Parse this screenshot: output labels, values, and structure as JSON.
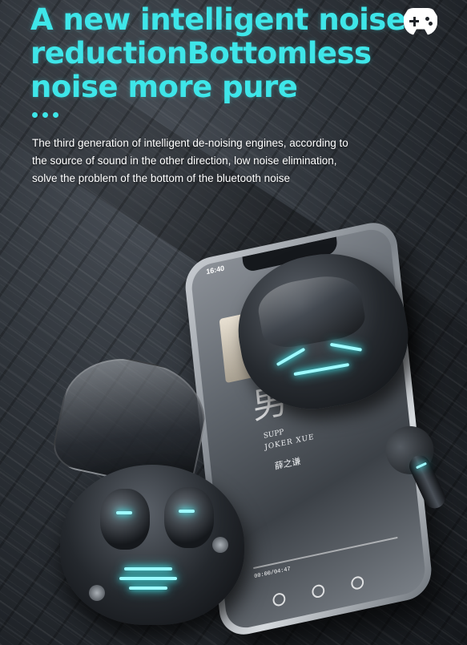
{
  "headline": {
    "line1": "A new intelligent noise",
    "line2": "reductionBottomless",
    "line3": "noise more pure"
  },
  "description": {
    "line1": "The third generation of intelligent de-noising engines, according to",
    "line2": "the source of sound in the other direction, low noise elimination,",
    "line3": "solve the problem of the bottom of the bluetooth noise"
  },
  "badge_icon": "game-controller-icon",
  "phone": {
    "status_time": "16:40",
    "album_title": "JOKER XUE",
    "album_sub": "SUPP",
    "artist": "薛之谦",
    "album_big_text": "男",
    "player_time": "00:00/04:47"
  },
  "colors": {
    "accent": "#3ee6e9",
    "text": "#ffffff",
    "background": "#2c3137"
  }
}
